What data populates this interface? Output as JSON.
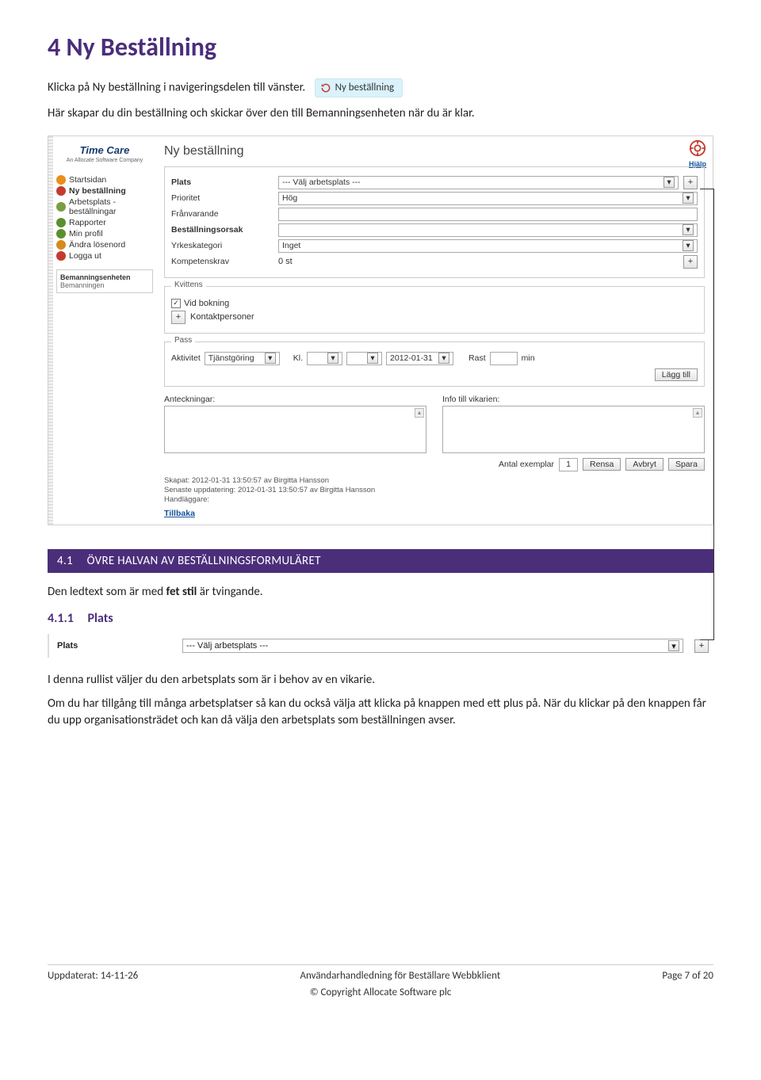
{
  "heading": "4  Ny Beställning",
  "intro1": "Klicka på Ny beställning i navigeringsdelen till vänster.",
  "inline_btn": {
    "label": "Ny beställning"
  },
  "intro2": "Här skapar du din beställning och skickar över den till Bemanningsenheten när du är klar.",
  "screenshot": {
    "logo_top": "Time Care",
    "logo_sub": "An Allocate Software Company",
    "nav": [
      {
        "label": "Startsidan",
        "bold": false,
        "color": "#e88f1a"
      },
      {
        "label": "Ny beställning",
        "bold": true,
        "color": "#c43a2e"
      },
      {
        "label": "Arbetsplats - beställningar",
        "bold": false,
        "color": "#7a9e3f"
      },
      {
        "label": "Rapporter",
        "bold": false,
        "color": "#5a8f2f"
      },
      {
        "label": "Min profil",
        "bold": false,
        "color": "#5a8f2f"
      },
      {
        "label": "Ändra lösenord",
        "bold": false,
        "color": "#d68a1a"
      },
      {
        "label": "Logga ut",
        "bold": false,
        "color": "#c43a2e"
      }
    ],
    "section_box": {
      "header": "Bemanningsenheten",
      "sub": "Bemanningen"
    },
    "content_title": "Ny beställning",
    "help_label": "Hjälp",
    "form": {
      "rows": [
        {
          "label": "Plats",
          "bold": true,
          "value": "--- Välj arbetsplats ---",
          "type": "select",
          "plus": true
        },
        {
          "label": "Prioritet",
          "bold": false,
          "value": "Hög",
          "type": "select",
          "plus": false
        },
        {
          "label": "Frånvarande",
          "bold": false,
          "value": "",
          "type": "text",
          "plus": false
        },
        {
          "label": "Beställningsorsak",
          "bold": true,
          "value": "",
          "type": "select",
          "plus": false
        },
        {
          "label": "Yrkeskategori",
          "bold": false,
          "value": "Inget",
          "type": "select",
          "plus": false
        },
        {
          "label": "Kompetenskrav",
          "bold": false,
          "value": "0 st",
          "type": "static",
          "plus": true
        }
      ]
    },
    "kvittens": {
      "legend": "Kvittens",
      "checkbox_label": "Vid bokning",
      "kontakt_btn": "Kontaktpersoner"
    },
    "pass": {
      "legend": "Pass",
      "aktivitet_label": "Aktivitet",
      "aktivitet_value": "Tjänstgöring",
      "kl_label": "Kl.",
      "date_value": "2012-01-31",
      "rast_label": "Rast",
      "min_label": "min",
      "add_btn": "Lägg till"
    },
    "notes": {
      "left_label": "Anteckningar:",
      "right_label": "Info till vikarien:"
    },
    "bottom": {
      "antal_label": "Antal exemplar",
      "antal_value": "1",
      "rensa": "Rensa",
      "avbryt": "Avbryt",
      "spara": "Spara"
    },
    "meta": {
      "l1": "Skapat: 2012-01-31 13:50:57 av Birgitta Hansson",
      "l2": "Senaste uppdatering: 2012-01-31 13:50:57 av Birgitta Hansson",
      "l3": "Handläggare:"
    },
    "back": "Tillbaka"
  },
  "section41": {
    "num": "4.1",
    "title": "ÖVRE HALVAN AV BESTÄLLNINGSFORMULÄRET"
  },
  "para_ledtext_a": "Den ledtext som är med ",
  "para_ledtext_b": "fet stil",
  "para_ledtext_c": " är tvingande.",
  "section411": {
    "num": "4.1.1",
    "title": "Plats"
  },
  "mini": {
    "label": "Plats",
    "value": "--- Välj arbetsplats ---"
  },
  "para_plats1": "I denna rullist väljer du den arbetsplats som är i behov av en vikarie.",
  "para_plats2": "Om du har tillgång till många arbetsplatser så kan du också välja att klicka på knappen med ett plus på. När du klickar på den knappen får du upp organisationsträdet och kan då välja den arbetsplats som beställningen avser.",
  "footer": {
    "left": "Uppdaterat: 14-11-26",
    "center": "Användarhandledning för Beställare Webbklient",
    "right": "Page 7 of 20",
    "copyright": "© Copyright Allocate Software plc"
  }
}
